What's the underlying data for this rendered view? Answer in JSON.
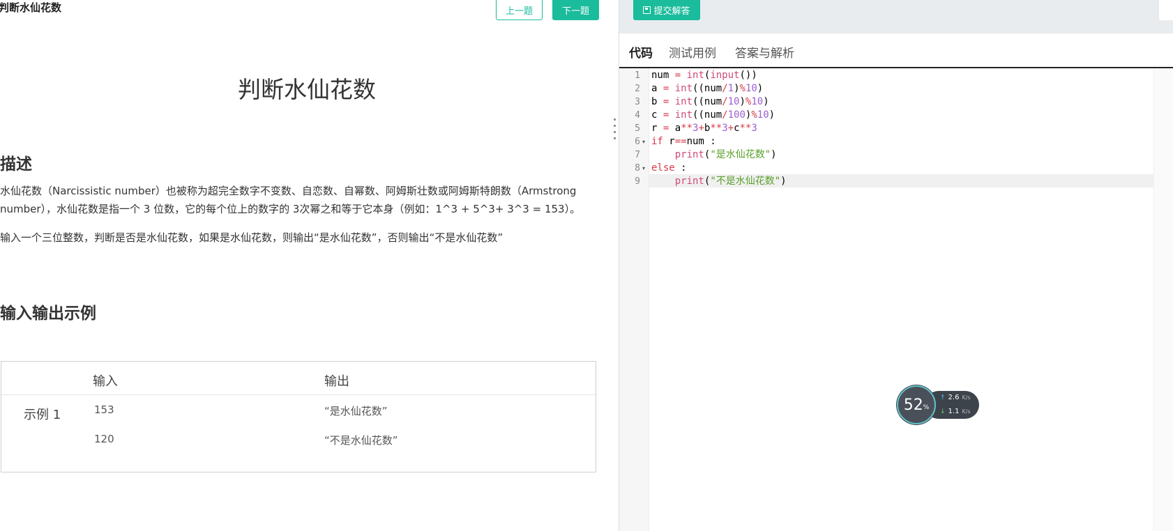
{
  "header": {
    "breadcrumb": "判断水仙花数",
    "prev_label": "上一题",
    "next_label": "下一题"
  },
  "problem": {
    "title": "判断水仙花数",
    "description_heading": "描述",
    "description_p1": "水仙花数（Narcissistic number）也被称为超完全数字不变数、自恋数、自幂数、阿姆斯壮数或阿姆斯特朗数（Armstrong number），水仙花数是指一个 3 位数，它的每个位上的数字的 3次幂之和等于它本身（例如：1^3 + 5^3+ 3^3 = 153）。",
    "description_p2": "输入一个三位整数，判断是否是水仙花数，如果是水仙花数，则输出“是水仙花数”，否则输出“不是水仙花数”",
    "io_heading": "输入输出示例",
    "table": {
      "col_input": "输入",
      "col_output": "输出",
      "example_label": "示例 1",
      "rows": [
        {
          "input": "153",
          "output": "“是水仙花数”"
        },
        {
          "input": "120",
          "output": "“不是水仙花数”"
        }
      ]
    }
  },
  "toolbar": {
    "submit_label": "提交解答"
  },
  "tabs": {
    "code": "代码",
    "tests": "测试用例",
    "answer": "答案与解析"
  },
  "editor": {
    "line_numbers": [
      "1",
      "2",
      "3",
      "4",
      "5",
      "6",
      "7",
      "8",
      "9"
    ],
    "lines": [
      "num = int(input())",
      "a = int((num/1)%10)",
      "b = int((num/10)%10)",
      "c = int((num/100)%10)",
      "r = a**3+b**3+c**3",
      "if r==num :",
      "    print(\"是水仙花数\")",
      "else :",
      "    print(\"不是水仙花数\")"
    ],
    "colors": {
      "keyword": "#d73a49",
      "builtin": "#d04a7a",
      "number": "#9c5fd0",
      "string": "#5aa02c",
      "operator": "#d73a49"
    }
  },
  "net_widget": {
    "percent": "52",
    "percent_sign": "%",
    "upload": "2.6",
    "download": "1.1",
    "unit": "K/s"
  }
}
